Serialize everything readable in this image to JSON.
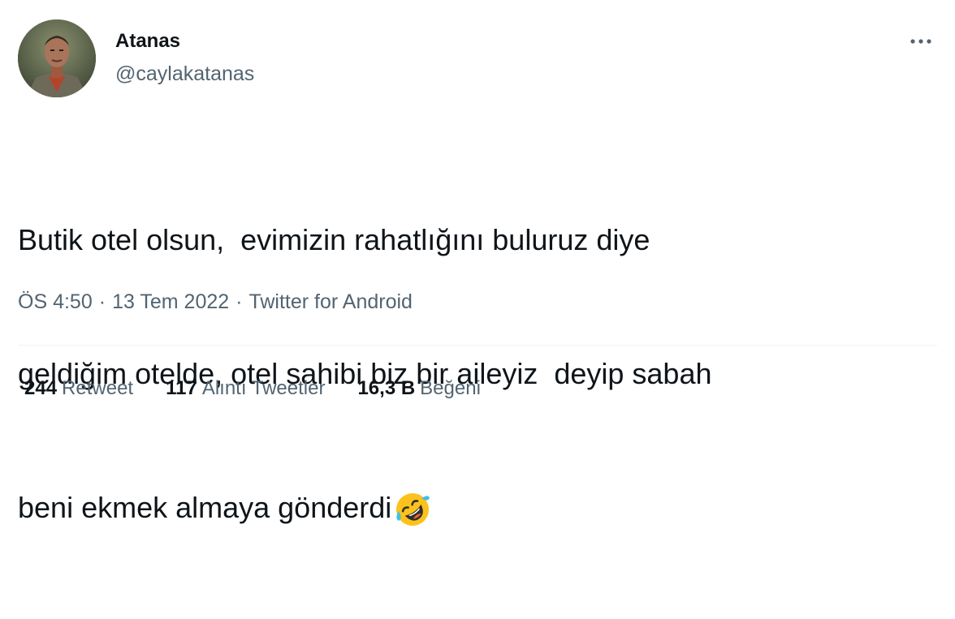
{
  "user": {
    "display_name": "Atanas",
    "handle": "@caylakatanas"
  },
  "tweet": {
    "lines": [
      "Butik otel olsun,  evimizin rahatlığını buluruz diye",
      "geldiğim otelde, otel sahibi biz bir aileyiz  deyip sabah",
      "beni ekmek almaya gönderdi"
    ],
    "emoji": "rolling-on-floor-laughing-emoji"
  },
  "meta": {
    "time": "ÖS 4:50",
    "separator": "·",
    "date": "13 Tem 2022",
    "source": "Twitter for Android"
  },
  "stats": [
    {
      "value": "244",
      "label": "Retweet"
    },
    {
      "value": "117",
      "label": "Alıntı Tweetler"
    },
    {
      "value": "16,3 B",
      "label": "Beğeni"
    }
  ],
  "icons": {
    "more": "more-horizontal-icon"
  },
  "colors": {
    "text_primary": "#0f1419",
    "text_secondary": "#536471",
    "divider": "#eff3f4"
  }
}
